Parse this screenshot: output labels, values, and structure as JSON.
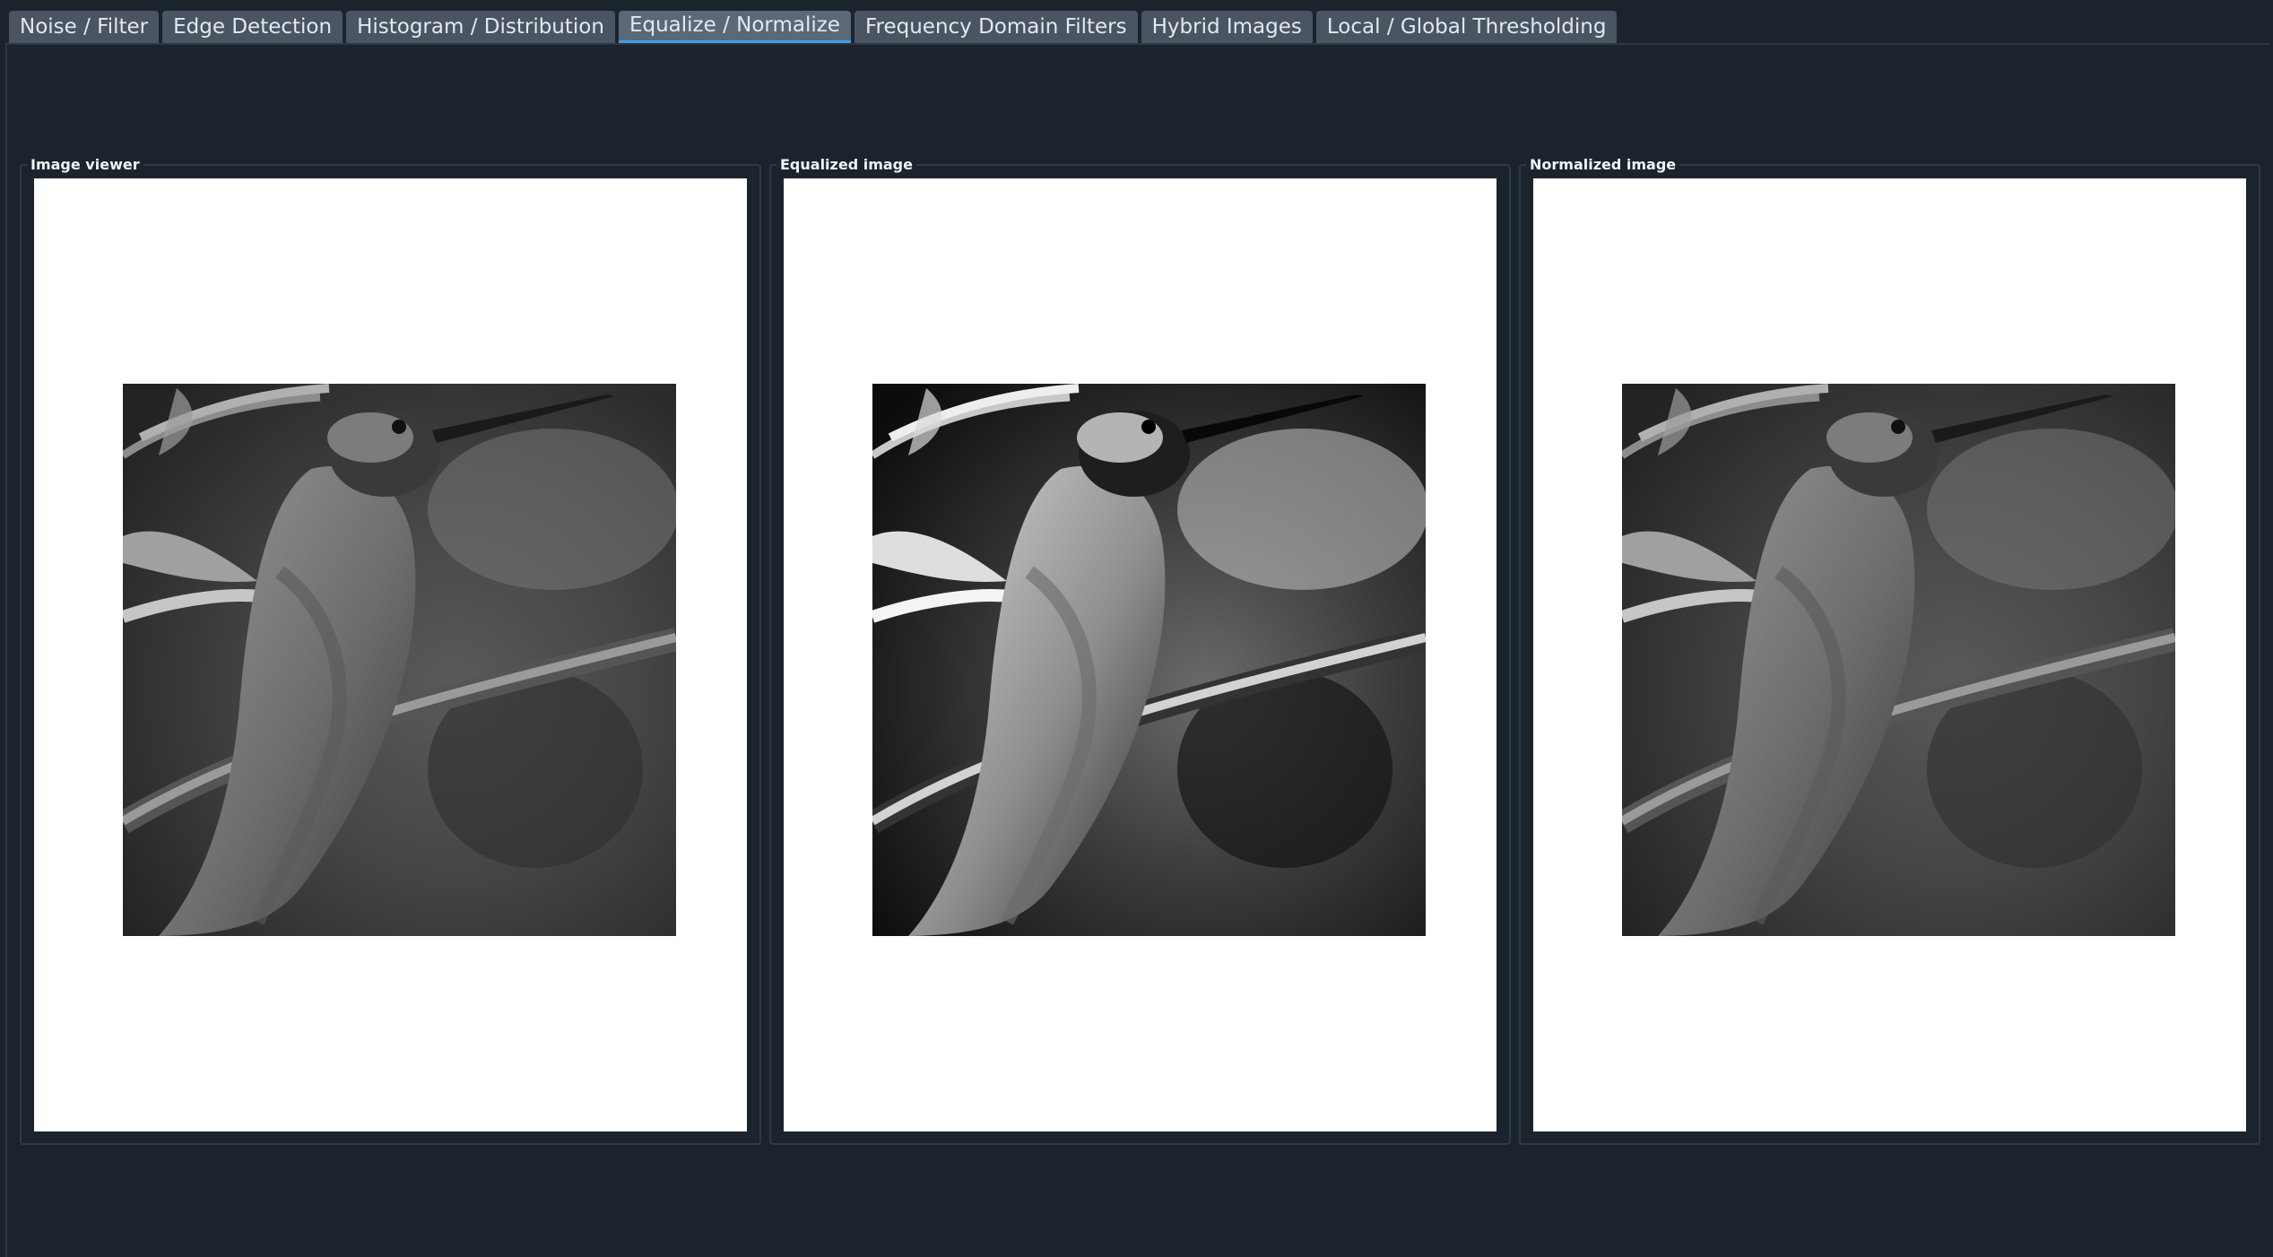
{
  "tabs": [
    {
      "label": "Noise / Filter",
      "active": false
    },
    {
      "label": "Edge Detection",
      "active": false
    },
    {
      "label": "Histogram / Distribution",
      "active": false
    },
    {
      "label": "Equalize / Normalize",
      "active": true
    },
    {
      "label": "Frequency Domain Filters",
      "active": false
    },
    {
      "label": "Hybrid Images",
      "active": false
    },
    {
      "label": "Local / Global Thresholding",
      "active": false
    }
  ],
  "panels": {
    "original": {
      "title": "Image viewer"
    },
    "equalized": {
      "title": "Equalized image"
    },
    "normalized": {
      "title": "Normalized image"
    }
  },
  "colors": {
    "background": "#1b232d",
    "tab": "#4a5563",
    "active_tab_underline": "#3ea0e6",
    "viewer_canvas": "#ffffff"
  },
  "icons": {
    "image_content": "hummingbird-grayscale-photo"
  }
}
